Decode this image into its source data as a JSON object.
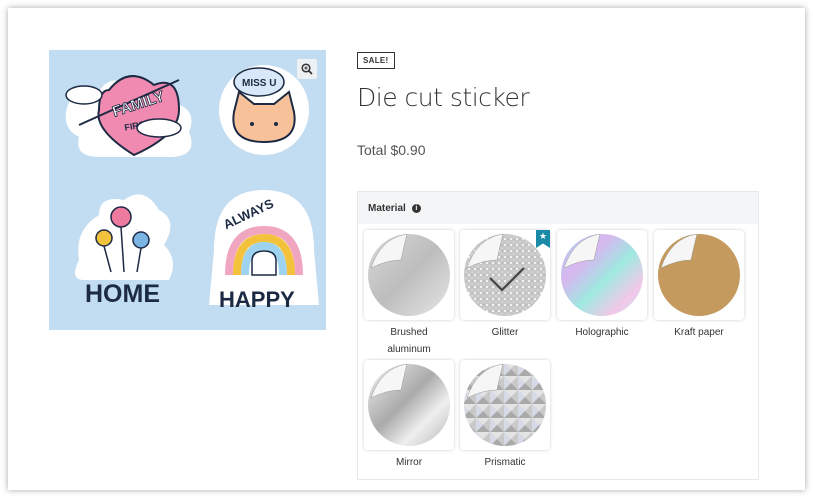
{
  "product": {
    "badge": "SALE!",
    "title": "Die cut sticker",
    "total": "Total $0.90"
  },
  "image": {
    "background": "#c2dcf2",
    "zoom_icon": "zoom-in-icon",
    "stickers": {
      "family_line1": "FAMILY",
      "family_line2": "FIRST",
      "miss_u": "MISS U",
      "home": "HOME",
      "always": "ALWAYS",
      "happy": "HAPPY"
    }
  },
  "options": {
    "label": "Material",
    "info_icon": "info-icon",
    "selected": "Glitter",
    "swatches": [
      {
        "label": "Brushed aluminum",
        "style": "brushed"
      },
      {
        "label": "Glitter",
        "style": "glitter",
        "selected": true,
        "featured": true
      },
      {
        "label": "Holographic",
        "style": "holographic"
      },
      {
        "label": "Kraft paper",
        "style": "kraft"
      },
      {
        "label": "Mirror",
        "style": "mirror"
      },
      {
        "label": "Prismatic",
        "style": "prismatic"
      }
    ]
  },
  "colors": {
    "featured_flag": "#1a8aa6",
    "kraft": "#c49a5e"
  }
}
